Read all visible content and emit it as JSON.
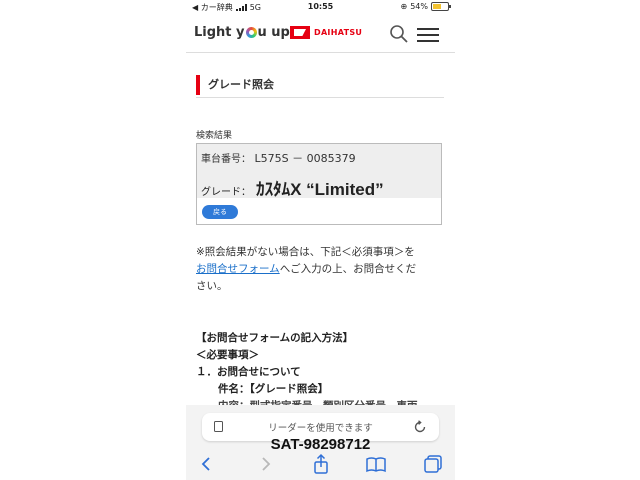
{
  "status": {
    "carrier": "◀ カー辞典",
    "network": "5G",
    "time": "10:55",
    "battery": "54%",
    "battery_level": 0.54
  },
  "header": {
    "logo_text_a": "Light y",
    "logo_text_b": "u up",
    "brand": "DAIHATSU",
    "brand_color": "#e60012"
  },
  "section": {
    "title": "グレード照会"
  },
  "result": {
    "label": "検索結果",
    "chassis_label": "車台番号：",
    "chassis_value": "L575S － 0085379",
    "grade_label": "グレード：",
    "grade_value": "ｶｽﾀﾑX “Limited”",
    "back_label": "戻る"
  },
  "note": {
    "line1": "※照会結果がない場合は、下記＜必須事項＞を",
    "link": "お問合せフォーム",
    "line2": "へご入力の上、お問合せくだ",
    "line3": "さい。"
  },
  "form": {
    "heading": "【お問合せフォームの記入方法】",
    "required": "＜必要事項＞",
    "item1": "１．お問合せについて",
    "subject": "件名：【グレード照会】",
    "content": "内容：型式指定番号、類別区分番号、車両"
  },
  "browser": {
    "reader_text": "リーダーを使用できます",
    "watermark": "SAT-98298712"
  },
  "icons": {
    "search": "search-icon",
    "menu": "menu-icon",
    "reader": "reader-doc-icon",
    "reload": "reload-icon",
    "back": "chevron-left-icon",
    "forward": "chevron-right-icon",
    "share": "share-icon",
    "bookmarks": "book-icon",
    "tabs": "tabs-icon"
  },
  "colors": {
    "accent": "#e60012",
    "link": "#1a6fc9",
    "button": "#2f7ad8",
    "ios_blue": "#2f6fd6"
  }
}
